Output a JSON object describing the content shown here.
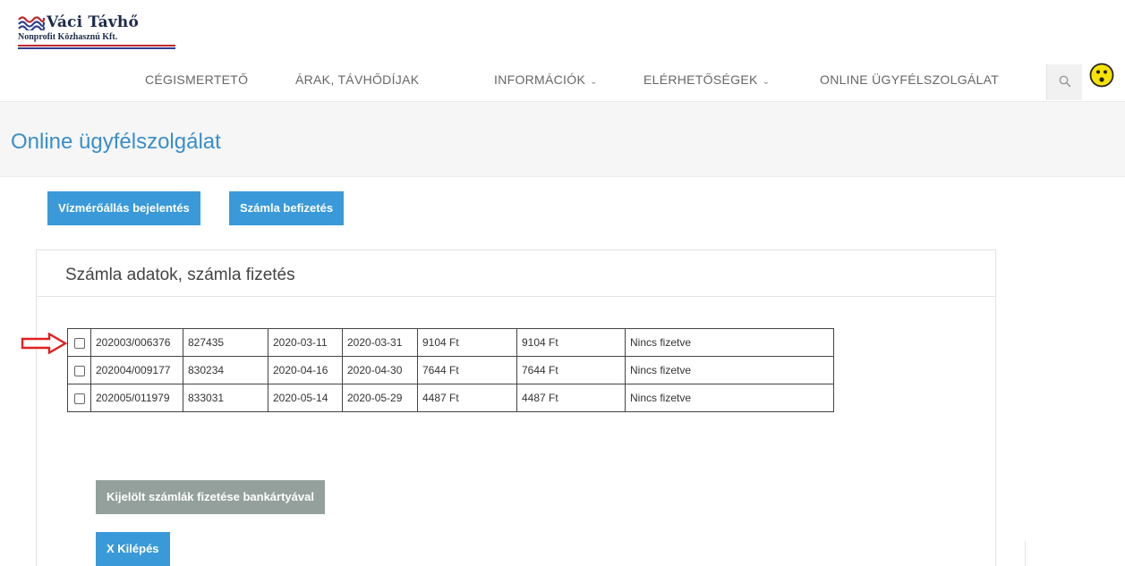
{
  "logo": {
    "title": "Váci Távhő",
    "subtitle": "Nonprofit Közhasznú Kft."
  },
  "nav": {
    "items": [
      {
        "label": "CÉGISMERTETŐ",
        "has_dropdown": false
      },
      {
        "label": "ÁRAK, TÁVHŐDÍJAK",
        "has_dropdown": false
      },
      {
        "label": "INFORMÁCIÓK",
        "has_dropdown": true
      },
      {
        "label": "ELÉRHETŐSÉGEK",
        "has_dropdown": true
      },
      {
        "label": "ONLINE ÜGYFÉLSZOLGÁLAT",
        "has_dropdown": false
      }
    ],
    "chevron": "⌄",
    "search_icon": "search-icon",
    "accessibility_icon": "smiley-icon"
  },
  "page": {
    "title": "Online ügyfélszolgálat"
  },
  "actions": {
    "meter_report": "Vízmérőállás bejelentés",
    "bill_pay": "Számla befizetés"
  },
  "panel": {
    "title": "Számla adatok, számla fizetés"
  },
  "invoices": [
    {
      "checked": false,
      "number": "202003/006376",
      "id": "827435",
      "issue_date": "2020-03-11",
      "due_date": "2020-03-31",
      "amount": "9104 Ft",
      "balance": "9104 Ft",
      "status": "Nincs fizetve"
    },
    {
      "checked": false,
      "number": "202004/009177",
      "id": "830234",
      "issue_date": "2020-04-16",
      "due_date": "2020-04-30",
      "amount": "7644 Ft",
      "balance": "7644 Ft",
      "status": "Nincs fizetve"
    },
    {
      "checked": false,
      "number": "202005/011979",
      "id": "833031",
      "issue_date": "2020-05-14",
      "due_date": "2020-05-29",
      "amount": "4487 Ft",
      "balance": "4487 Ft",
      "status": "Nincs fizetve"
    }
  ],
  "buttons": {
    "pay_card": "Kijelölt számlák fizetése bankártyával",
    "logout": "X Kilépés"
  },
  "colors": {
    "accent": "#3a9ad9",
    "title": "#3a8ec9",
    "arrow": "#e02020",
    "disabled": "#93a09c"
  }
}
